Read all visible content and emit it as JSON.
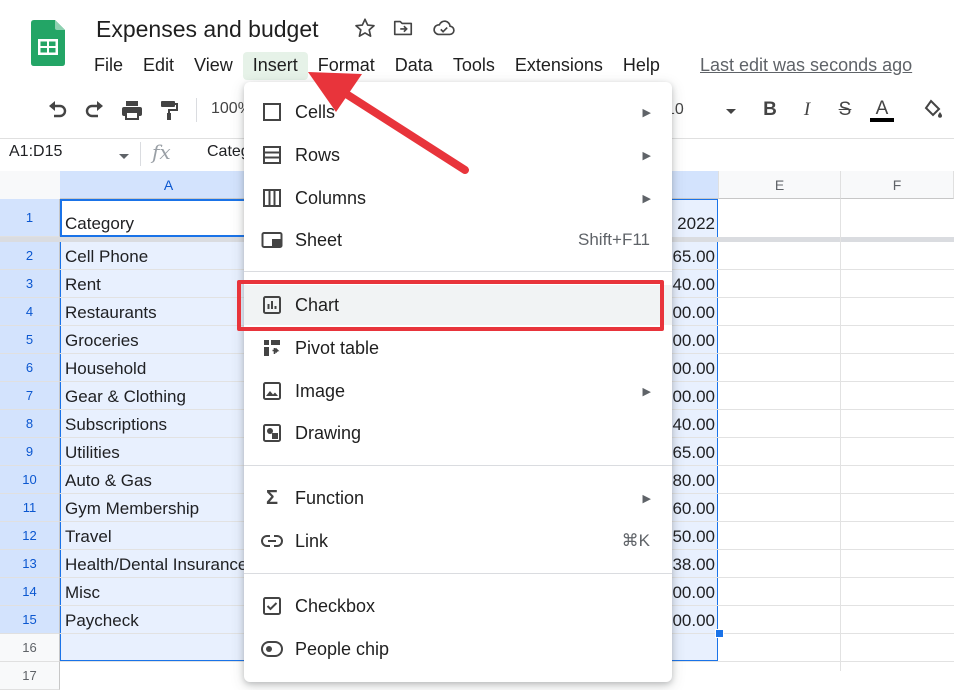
{
  "app": {
    "title": "Expenses and budget",
    "last_edit": "Last edit was seconds ago",
    "menu": [
      "File",
      "Edit",
      "View",
      "Insert",
      "Format",
      "Data",
      "Tools",
      "Extensions",
      "Help"
    ],
    "active_menu": "Insert"
  },
  "toolbar": {
    "zoom": "100%",
    "font_size": "10"
  },
  "formula_bar": {
    "name_box": "A1:D15",
    "value": "Category"
  },
  "grid": {
    "columns": [
      "A",
      "E",
      "F"
    ],
    "rows": [
      "1",
      "2",
      "3",
      "4",
      "5",
      "6",
      "7",
      "8",
      "9",
      "10",
      "11",
      "12",
      "13",
      "14",
      "15",
      "16",
      "17"
    ],
    "column_a": [
      "Category",
      "Cell Phone",
      "Rent",
      "Restaurants",
      "Groceries",
      "Household",
      "Gear & Clothing",
      "Subscriptions",
      "Utilities",
      "Auto & Gas",
      "Gym Membership",
      "Travel",
      "Health/Dental Insurance",
      "Misc",
      "Paycheck"
    ],
    "column_d": [
      "2022",
      "65.00",
      "40.00",
      "00.00",
      "00.00",
      "00.00",
      "00.00",
      "40.00",
      "65.00",
      "80.00",
      "60.00",
      "50.00",
      "38.00",
      "00.00",
      "00.00"
    ]
  },
  "insert_menu": {
    "items": [
      {
        "label": "Cells",
        "icon": "cells-icon",
        "submenu": true
      },
      {
        "label": "Rows",
        "icon": "rows-icon",
        "submenu": true
      },
      {
        "label": "Columns",
        "icon": "columns-icon",
        "submenu": true
      },
      {
        "label": "Sheet",
        "icon": "sheet-icon",
        "shortcut": "Shift+F11"
      },
      {
        "label": "Chart",
        "icon": "chart-icon",
        "highlighted": true
      },
      {
        "label": "Pivot table",
        "icon": "pivot-table-icon"
      },
      {
        "label": "Image",
        "icon": "image-icon",
        "submenu": true
      },
      {
        "label": "Drawing",
        "icon": "drawing-icon"
      },
      {
        "label": "Function",
        "icon": "sigma-icon",
        "submenu": true
      },
      {
        "label": "Link",
        "icon": "link-icon",
        "shortcut": "⌘K"
      },
      {
        "label": "Checkbox",
        "icon": "checkbox-icon"
      },
      {
        "label": "People chip",
        "icon": "person-icon"
      }
    ]
  },
  "colors": {
    "accent_red": "#e8343b",
    "selection_fill": "#e8f0fe",
    "selection_border": "#1a73e8",
    "sheets_green": "#23a566"
  }
}
